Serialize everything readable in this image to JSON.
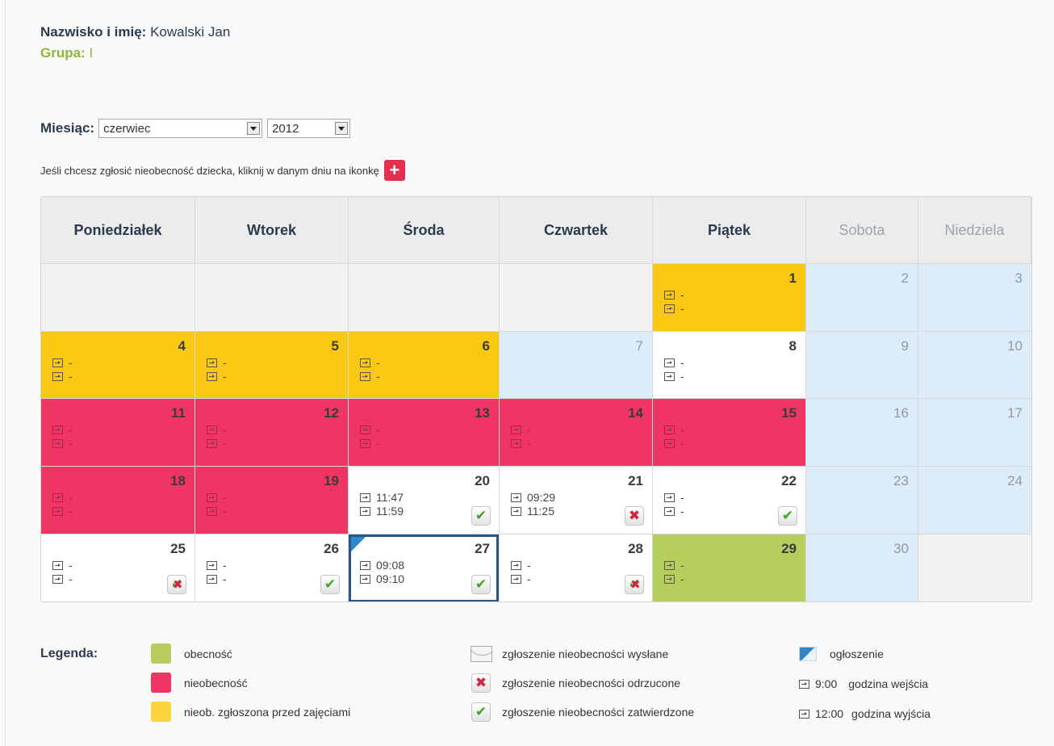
{
  "person": {
    "name_label": "Nazwisko i imię:",
    "name_value": "Kowalski Jan",
    "group_label": "Grupa:",
    "group_value": "I"
  },
  "filters": {
    "month_label": "Miesiąc:",
    "month_value": "czerwiec",
    "year_value": "2012"
  },
  "hint_text": "Jeśli chcesz zgłosić nieobecność dziecka, kliknij w danym dniu na ikonkę",
  "calendar": {
    "weekdays": [
      "Poniedziałek",
      "Wtorek",
      "Środa",
      "Czwartek",
      "Piątek",
      "Sobota",
      "Niedziela"
    ],
    "rows": [
      [
        {
          "day": "",
          "type": "empty"
        },
        {
          "day": "",
          "type": "empty"
        },
        {
          "day": "",
          "type": "empty"
        },
        {
          "day": "",
          "type": "empty"
        },
        {
          "day": "1",
          "type": "yellow",
          "in": "-",
          "out": "-"
        },
        {
          "day": "2",
          "type": "blue"
        },
        {
          "day": "3",
          "type": "blue"
        }
      ],
      [
        {
          "day": "4",
          "type": "yellow",
          "in": "-",
          "out": "-"
        },
        {
          "day": "5",
          "type": "yellow",
          "in": "-",
          "out": "-"
        },
        {
          "day": "6",
          "type": "yellow",
          "in": "-",
          "out": "-"
        },
        {
          "day": "7",
          "type": "blue"
        },
        {
          "day": "8",
          "type": "white",
          "in": "-",
          "out": "-"
        },
        {
          "day": "9",
          "type": "blue"
        },
        {
          "day": "10",
          "type": "blue"
        }
      ],
      [
        {
          "day": "11",
          "type": "red",
          "in": "-",
          "out": "-"
        },
        {
          "day": "12",
          "type": "red",
          "in": "-",
          "out": "-"
        },
        {
          "day": "13",
          "type": "red",
          "in": "-",
          "out": "-"
        },
        {
          "day": "14",
          "type": "red",
          "in": "-",
          "out": "-"
        },
        {
          "day": "15",
          "type": "red",
          "in": "-",
          "out": "-"
        },
        {
          "day": "16",
          "type": "blue"
        },
        {
          "day": "17",
          "type": "blue"
        }
      ],
      [
        {
          "day": "18",
          "type": "red",
          "in": "-",
          "out": "-"
        },
        {
          "day": "19",
          "type": "red",
          "in": "-",
          "out": "-"
        },
        {
          "day": "20",
          "type": "white",
          "in": "11:47",
          "out": "11:59",
          "badge": "approved"
        },
        {
          "day": "21",
          "type": "white",
          "in": "09:29",
          "out": "11:25",
          "badge": "rejected"
        },
        {
          "day": "22",
          "type": "white",
          "in": "-",
          "out": "-",
          "badge": "approved"
        },
        {
          "day": "23",
          "type": "blue"
        },
        {
          "day": "24",
          "type": "blue"
        }
      ],
      [
        {
          "day": "25",
          "type": "white",
          "in": "-",
          "out": "-",
          "badge": "mixed"
        },
        {
          "day": "26",
          "type": "white",
          "in": "-",
          "out": "-",
          "badge": "approved"
        },
        {
          "day": "27",
          "type": "white",
          "in": "09:08",
          "out": "09:10",
          "badge": "approved",
          "today": true,
          "announcement": true
        },
        {
          "day": "28",
          "type": "white",
          "in": "-",
          "out": "-",
          "badge": "mixed"
        },
        {
          "day": "29",
          "type": "green",
          "in": "-",
          "out": "-"
        },
        {
          "day": "30",
          "type": "blue"
        },
        {
          "day": "",
          "type": "empty"
        }
      ]
    ]
  },
  "legend": {
    "title": "Legenda:",
    "presence": "obecność",
    "absence": "nieobecność",
    "absence_reported": "nieob. zgłoszona przed zajęciami",
    "report_sent": "zgłoszenie nieobecności wysłane",
    "report_rejected": "zgłoszenie nieobecności odrzucone",
    "report_approved": "zgłoszenie nieobecności zatwierdzone",
    "announcement": "ogłoszenie",
    "entry_time_example": "9:00",
    "entry_time_label": "godzina wejścia",
    "exit_time_example": "12:00",
    "exit_time_label": "godzina wyjścia"
  },
  "colors": {
    "presence": "#b5ce5c",
    "absence": "#ee3563",
    "absence_reported": "#f8c812",
    "weekend": "#dcecf8",
    "today_border": "#2b5584",
    "approved_icon": "#3da324",
    "rejected_icon": "#d52540"
  }
}
